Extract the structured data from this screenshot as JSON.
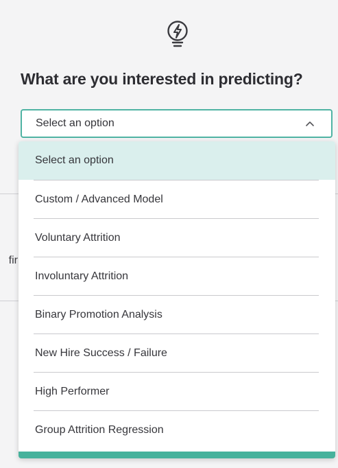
{
  "title": "What are you interested in predicting?",
  "icon": "lightbulb-bolt-icon",
  "background_fragment": "fir",
  "select": {
    "value": "Select an option",
    "expanded": true,
    "options": [
      "Select an option",
      "Custom / Advanced Model",
      "Voluntary Attrition",
      "Involuntary Attrition",
      "Binary Promotion Analysis",
      "New Hire Success / Failure",
      "High Performer",
      "Group Attrition Regression"
    ],
    "selected_index": 0
  },
  "colors": {
    "accent": "#4fb3a3",
    "selected_bg": "#daefed",
    "bottom_bar": "#46b29c"
  }
}
